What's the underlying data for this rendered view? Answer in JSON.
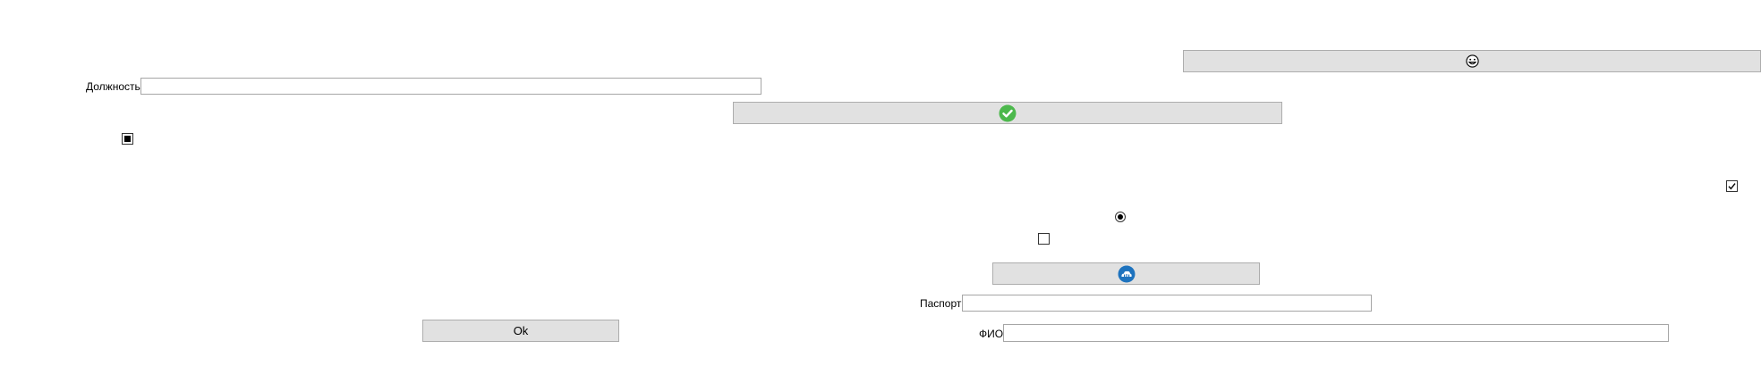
{
  "form": {
    "position_label": "Должность",
    "position_value": "",
    "passport_label": "Паспорт",
    "passport_value": "",
    "fullname_label": "ФИО",
    "fullname_value": "",
    "ok_label": "Ok"
  },
  "controls": {
    "checkbox_top_left_state": "indeterminate",
    "checkbox_right_state": "checked",
    "radio_state": "selected",
    "checkbox_center_state": "unchecked"
  },
  "icons": {
    "emoji_button_icon": "grinning-face-icon",
    "confirm_button_icon": "green-check-circle-icon",
    "cloud_button_icon": "blue-circle-icon"
  },
  "colors": {
    "button_bg": "#e1e1e1",
    "button_border": "#adadad",
    "check_green": "#4cb84c",
    "icon_blue": "#1e73be"
  }
}
